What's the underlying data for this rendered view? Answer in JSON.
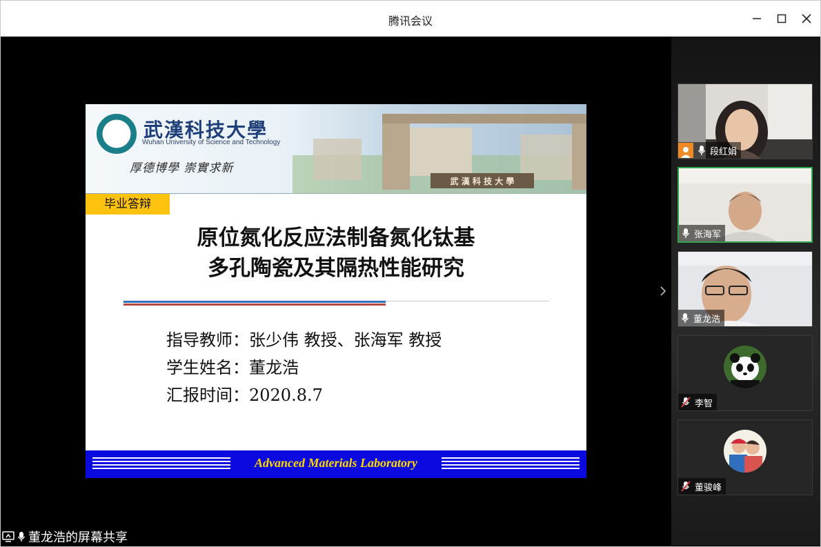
{
  "window": {
    "title": "腾讯会议"
  },
  "slide": {
    "university_cn": "武漢科技大學",
    "university_en": "Wuhan University of Science and Technology",
    "motto": "厚德博學 崇實求新",
    "gate_sign": "武 漢 科 技 大 學",
    "tag": "毕业答辩",
    "thesis_title_line1": "原位氮化反应法制备氮化钛基",
    "thesis_title_line2": "多孔陶瓷及其隔热性能研究",
    "advisor_line": "指导教师：张少伟  教授、张海军  教授",
    "student_line": "学生姓名：董龙浩",
    "date_line": "汇报时间：2020.8.7",
    "footer": "Advanced Materials Laboratory"
  },
  "participants": [
    {
      "name": "段红娟",
      "mic": "on",
      "badge": "person"
    },
    {
      "name": "张海军",
      "mic": "on",
      "active": true
    },
    {
      "name": "董龙浩",
      "mic": "on"
    },
    {
      "name": "李智",
      "mic": "muted",
      "avatar": "panda"
    },
    {
      "name": "董骏峰",
      "mic": "muted",
      "avatar": "kids"
    }
  ],
  "share_status": "董龙浩的屏幕共享",
  "colors": {
    "accent_green": "#2ea44f",
    "tag_yellow": "#ffc20e",
    "footer_blue": "#0a0ae0",
    "muted_red": "#e04040"
  }
}
